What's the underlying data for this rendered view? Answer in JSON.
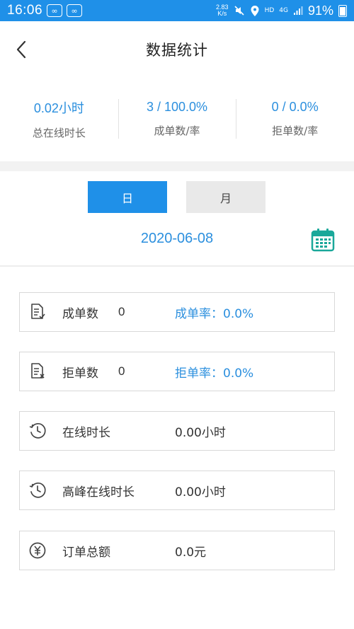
{
  "status_bar": {
    "time": "16:06",
    "network_speed_value": "2.83",
    "network_speed_unit": "K/s",
    "hd_label": "HD",
    "network_type": "4G",
    "battery": "91%"
  },
  "header": {
    "title": "数据统计"
  },
  "summary": [
    {
      "value": "0.02小时",
      "label": "总在线时长"
    },
    {
      "value": "3 / 100.0%",
      "label": "成单数/率"
    },
    {
      "value": "0 / 0.0%",
      "label": "拒单数/率"
    }
  ],
  "tabs": {
    "day": "日",
    "month": "月",
    "active": "day"
  },
  "date": "2020-06-08",
  "stats": {
    "completed": {
      "label": "成单数",
      "count": "0",
      "rate": "成单率：0.0%"
    },
    "rejected": {
      "label": "拒单数",
      "count": "0",
      "rate": "拒单率：0.0%"
    },
    "online": {
      "label": "在线时长",
      "value": "0.00小时"
    },
    "peak_online": {
      "label": "高峰在线时长",
      "value": "0.00小时"
    },
    "order_total": {
      "label": "订单总额",
      "value": "0.0元"
    }
  },
  "colors": {
    "accent": "#1f90e8",
    "link": "#2b8fde",
    "calendar": "#1aa89a"
  },
  "icons": {
    "back": "chevron-left-icon",
    "calendar": "calendar-icon",
    "completed": "document-check-icon",
    "rejected": "document-x-icon",
    "clock": "clock-icon",
    "yuan": "yuan-circle-icon"
  }
}
